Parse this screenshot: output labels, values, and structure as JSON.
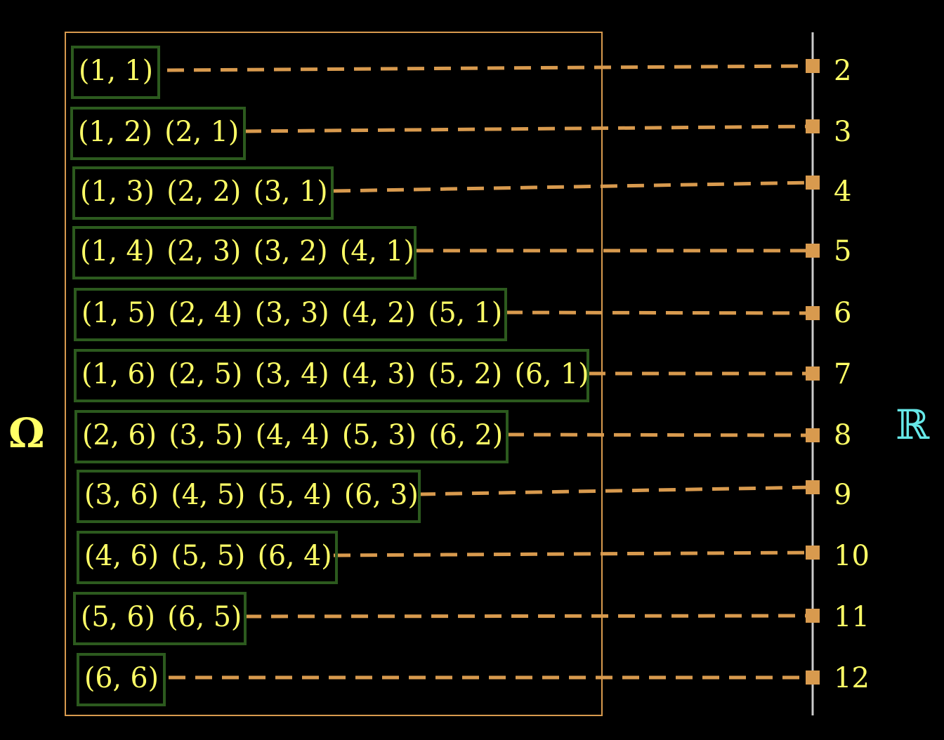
{
  "sample_space_label": "Ω",
  "codomain_label": "ℝ",
  "colors": {
    "background": "#000000",
    "text": "#ffff66",
    "group_box": "#2c5a1e",
    "outer_box": "#d89a4e",
    "dash": "#d89a4e",
    "axis": "#cccccc",
    "reals": "#66e8e8"
  },
  "groups": [
    {
      "sum": "2",
      "outcomes": [
        "(1, 1)"
      ]
    },
    {
      "sum": "3",
      "outcomes": [
        "(1, 2)",
        "(2, 1)"
      ]
    },
    {
      "sum": "4",
      "outcomes": [
        "(1, 3)",
        "(2, 2)",
        "(3, 1)"
      ]
    },
    {
      "sum": "5",
      "outcomes": [
        "(1, 4)",
        "(2, 3)",
        "(3, 2)",
        "(4, 1)"
      ]
    },
    {
      "sum": "6",
      "outcomes": [
        "(1, 5)",
        "(2, 4)",
        "(3, 3)",
        "(4, 2)",
        "(5, 1)"
      ]
    },
    {
      "sum": "7",
      "outcomes": [
        "(1, 6)",
        "(2, 5)",
        "(3, 4)",
        "(4, 3)",
        "(5, 2)",
        "(6, 1)"
      ]
    },
    {
      "sum": "8",
      "outcomes": [
        "(2, 6)",
        "(3, 5)",
        "(4, 4)",
        "(5, 3)",
        "(6, 2)"
      ]
    },
    {
      "sum": "9",
      "outcomes": [
        "(3, 6)",
        "(4, 5)",
        "(5, 4)",
        "(6, 3)"
      ]
    },
    {
      "sum": "10",
      "outcomes": [
        "(4, 6)",
        "(5, 5)",
        "(6, 4)"
      ]
    },
    {
      "sum": "11",
      "outcomes": [
        "(5, 6)",
        "(6, 5)"
      ]
    },
    {
      "sum": "12",
      "outcomes": [
        "(6, 6)"
      ]
    }
  ]
}
